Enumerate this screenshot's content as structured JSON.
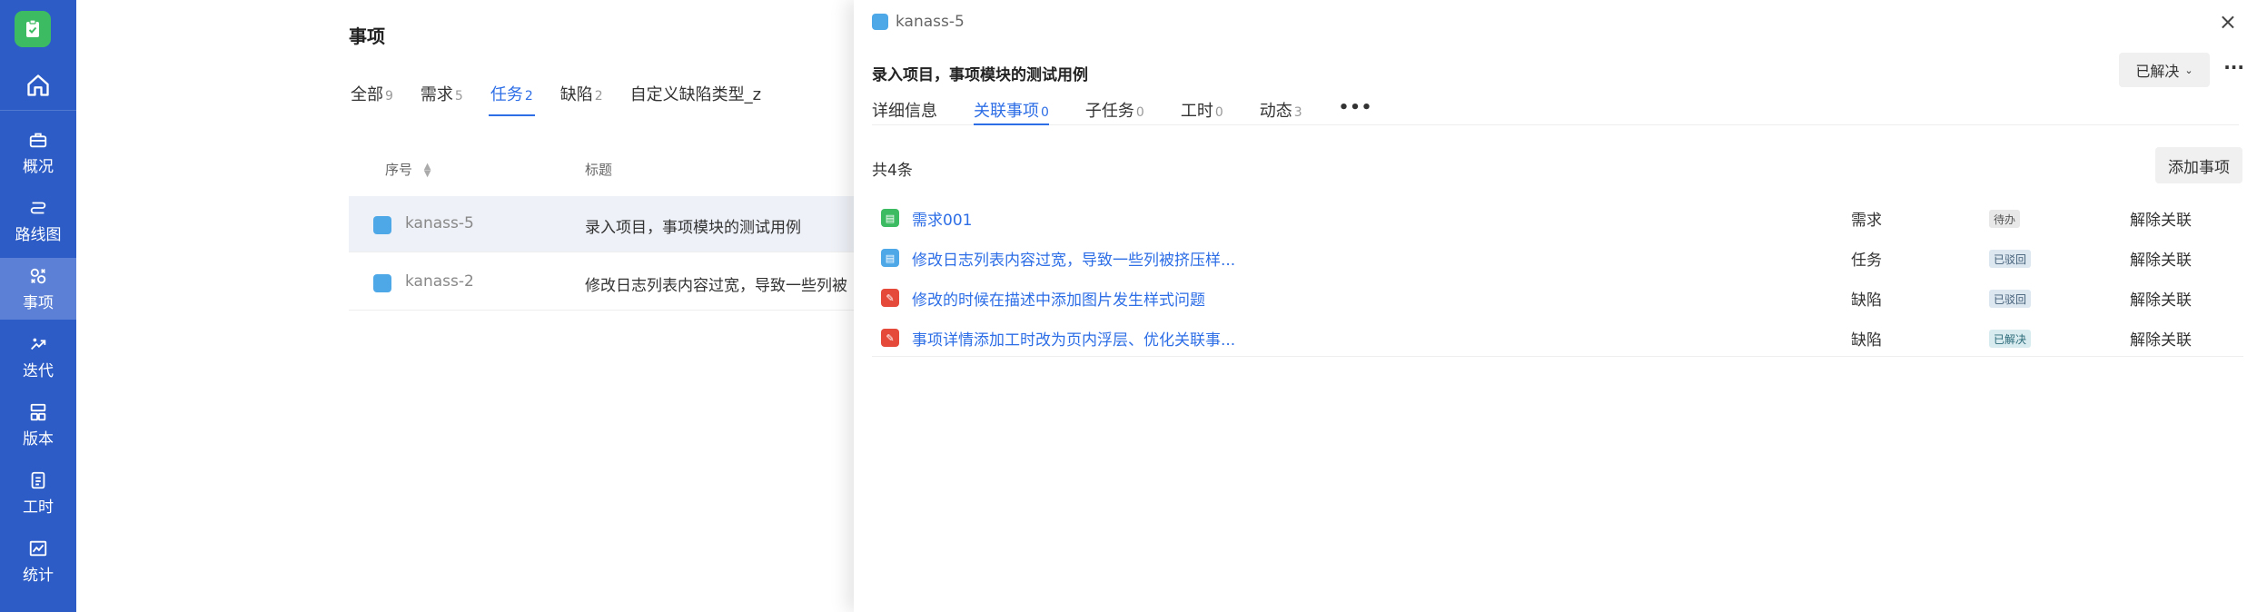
{
  "sidebar": {
    "items": [
      {
        "label": "概况",
        "icon": "briefcase-icon"
      },
      {
        "label": "路线图",
        "icon": "route-icon"
      },
      {
        "label": "事项",
        "icon": "items-icon",
        "active": true
      },
      {
        "label": "迭代",
        "icon": "sprint-icon"
      },
      {
        "label": "版本",
        "icon": "version-icon"
      },
      {
        "label": "工时",
        "icon": "clipboard-icon"
      },
      {
        "label": "统计",
        "icon": "chart-icon"
      }
    ]
  },
  "main": {
    "title": "事项",
    "tabs": [
      {
        "label": "全部",
        "count": "9"
      },
      {
        "label": "需求",
        "count": "5"
      },
      {
        "label": "任务",
        "count": "2",
        "active": true
      },
      {
        "label": "缺陷",
        "count": "2"
      },
      {
        "label": "自定义缺陷类型_z",
        "count": ""
      }
    ],
    "table": {
      "headers": {
        "id": "序号",
        "title": "标题"
      },
      "rows": [
        {
          "id": "kanass-5",
          "title": "录入项目，事项模块的测试用例"
        },
        {
          "id": "kanass-2",
          "title": "修改日志列表内容过宽，导致一些列被"
        }
      ]
    }
  },
  "drawer": {
    "breadcrumb": "kanass-5",
    "title": "录入项目，事项模块的测试用例",
    "status": "已解决",
    "tabs": [
      {
        "label": "详细信息",
        "count": ""
      },
      {
        "label": "关联事项",
        "count": "0",
        "active": true
      },
      {
        "label": "子任务",
        "count": "0"
      },
      {
        "label": "工时",
        "count": "0"
      },
      {
        "label": "动态",
        "count": "3"
      }
    ],
    "more_tabs": "•••",
    "total": "共4条",
    "add_button": "添加事项",
    "linked_items": [
      {
        "title": "需求001",
        "type": "需求",
        "status": "待办",
        "action": "解除关联",
        "color": "#3dbb63",
        "status_bg": "#e8e8e8",
        "status_fg": "#555"
      },
      {
        "title": "修改日志列表内容过宽，导致一些列被挤压样...",
        "type": "任务",
        "status": "已驳回",
        "action": "解除关联",
        "color": "#4ea8e8",
        "status_bg": "#dde7f0",
        "status_fg": "#44607a"
      },
      {
        "title": "修改的时候在描述中添加图片发生样式问题",
        "type": "缺陷",
        "status": "已驳回",
        "action": "解除关联",
        "color": "#e5493a",
        "status_bg": "#dde7f0",
        "status_fg": "#44607a"
      },
      {
        "title": "事项详情添加工时改为页内浮层、优化关联事...",
        "type": "缺陷",
        "status": "已解决",
        "action": "解除关联",
        "color": "#e5493a",
        "status_bg": "#d8ecf0",
        "status_fg": "#2b6a78"
      }
    ]
  }
}
